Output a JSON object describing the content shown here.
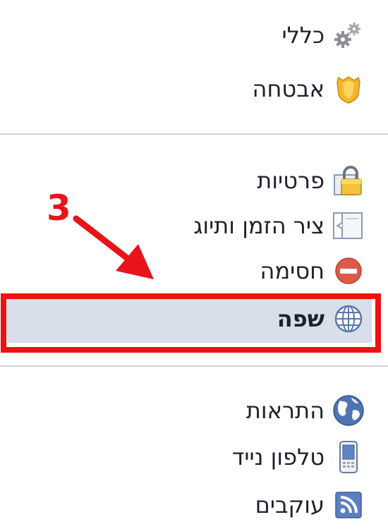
{
  "menu": {
    "groups": [
      {
        "items": [
          {
            "id": "general",
            "label": "כללי",
            "icon": "gears-icon"
          },
          {
            "id": "security",
            "label": "אבטחה",
            "icon": "shield-badge-icon"
          }
        ]
      },
      {
        "items": [
          {
            "id": "privacy",
            "label": "פרטיות",
            "icon": "padlock-icon"
          },
          {
            "id": "timeline",
            "label": "ציר הזמן ותיוג",
            "icon": "timeline-icon"
          },
          {
            "id": "blocking",
            "label": "חסימה",
            "icon": "no-entry-icon"
          },
          {
            "id": "language",
            "label": "שפה",
            "icon": "globe-grid-icon",
            "selected": true
          }
        ]
      },
      {
        "items": [
          {
            "id": "notifications",
            "label": "התראות",
            "icon": "world-globe-icon"
          },
          {
            "id": "mobile",
            "label": "טלפון נייד",
            "icon": "mobile-phone-icon"
          },
          {
            "id": "followers",
            "label": "עוקבים",
            "icon": "rss-feed-icon"
          }
        ]
      }
    ]
  },
  "annotation": {
    "step_number": "3",
    "color": "#e8141a"
  },
  "colors": {
    "selected_background": "#d8dfea",
    "highlight_border": "#ee1111",
    "divider": "#d3d6db"
  }
}
